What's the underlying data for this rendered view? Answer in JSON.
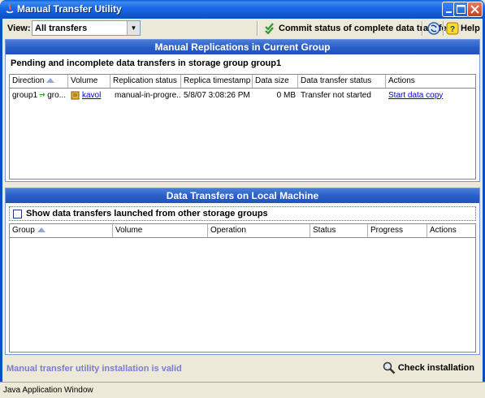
{
  "window": {
    "title": "Manual Transfer Utility"
  },
  "toolbar": {
    "view_label": "View:",
    "view_value": "All transfers",
    "commit_label": "Commit status of complete data transfers",
    "help_label": "Help"
  },
  "replications_panel": {
    "header": "Manual Replications in Current Group",
    "subtitle": "Pending and incomplete data transfers in storage group group1",
    "columns": [
      "Direction",
      "Volume",
      "Replication status",
      "Replica timestamp",
      "Data size",
      "Data transfer status",
      "Actions"
    ],
    "rows": [
      {
        "direction": "group1",
        "direction_target": "gro...",
        "volume": "kavol",
        "replication_status": "manual-in-progre...",
        "replica_timestamp": "5/8/07 3:08:26 PM",
        "data_size": "0 MB",
        "transfer_status": "Transfer not started",
        "action": "Start data copy"
      }
    ]
  },
  "local_panel": {
    "header": "Data Transfers on Local Machine",
    "checkbox_label": "Show data transfers launched from other storage groups",
    "columns": [
      "Group",
      "Volume",
      "Operation",
      "Status",
      "Progress",
      "Actions"
    ]
  },
  "status": {
    "message": "Manual transfer utility installation is valid",
    "check_label": "Check installation"
  },
  "taskbar": {
    "label": "Java Application Window"
  },
  "colors": {
    "title_bar": "#0a5fd8",
    "panel_header": "#2a5fc7",
    "status_text": "#7a7ad8",
    "link": "#0000ee"
  }
}
